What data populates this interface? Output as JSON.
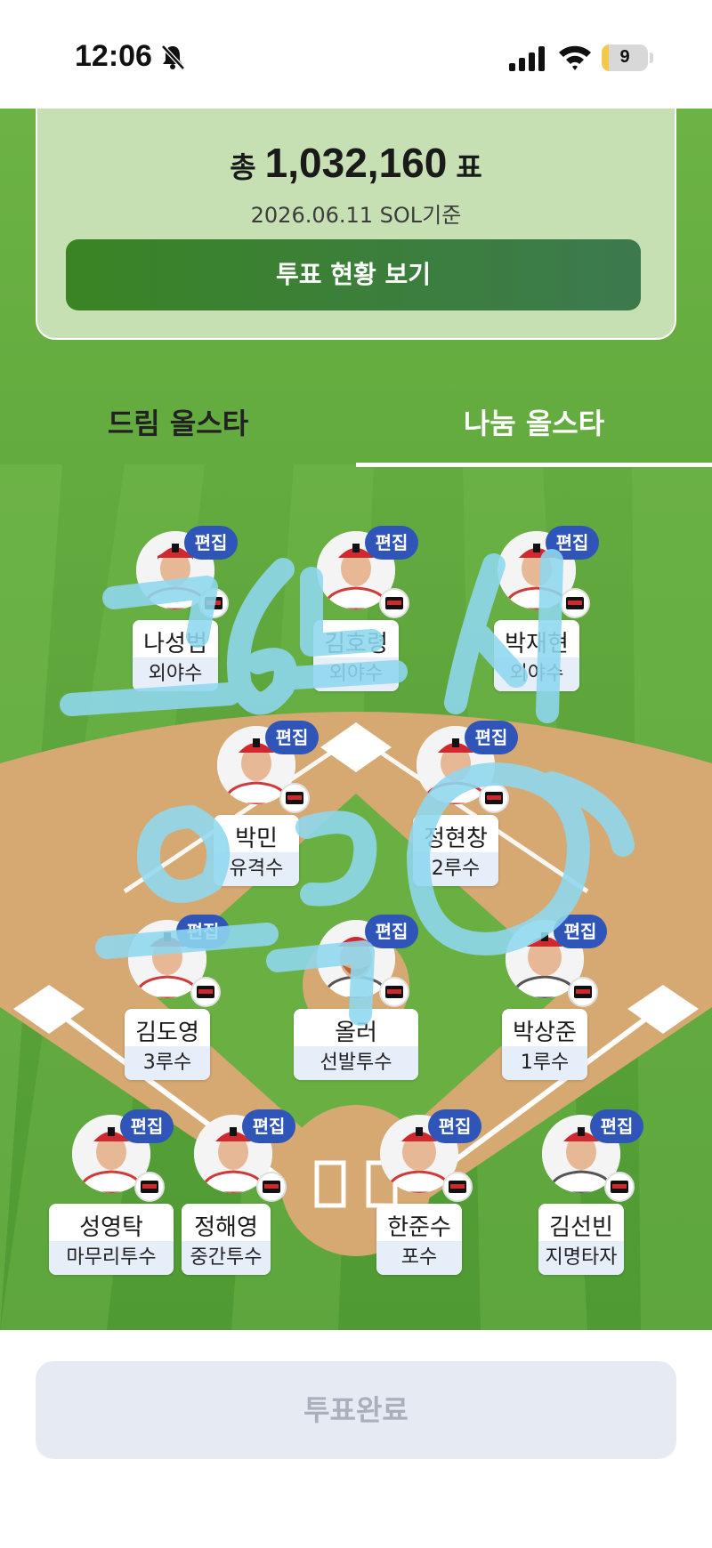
{
  "status_bar": {
    "time": "12:06",
    "battery": "9"
  },
  "summary": {
    "total_prefix": "총",
    "total_votes": "1,032,160",
    "total_suffix": "표",
    "basis": "2026.06.11 SOL기준",
    "status_button": "투표 현황 보기"
  },
  "tabs": [
    {
      "label": "드림 올스타",
      "selected": false
    },
    {
      "label": "나눔 올스타",
      "selected": true
    }
  ],
  "edit_label": "편집",
  "players": [
    {
      "name": "나성범",
      "position": "외야수"
    },
    {
      "name": "김호령",
      "position": "외야수"
    },
    {
      "name": "박재현",
      "position": "외야수"
    },
    {
      "name": "박민",
      "position": "유격수"
    },
    {
      "name": "정현창",
      "position": "2루수"
    },
    {
      "name": "김도영",
      "position": "3루수"
    },
    {
      "name": "올러",
      "position": "선발투수"
    },
    {
      "name": "박상준",
      "position": "1루수"
    },
    {
      "name": "성영탁",
      "position": "마무리투수"
    },
    {
      "name": "정해영",
      "position": "중간투수"
    },
    {
      "name": "한준수",
      "position": "포수"
    },
    {
      "name": "김선빈",
      "position": "지명타자"
    }
  ],
  "complete_button": "투표완료",
  "colors": {
    "grass": "#6db343",
    "infield": "#d6a872",
    "edit_badge": "#2f55b8",
    "scribble": "#8fd8f0"
  }
}
